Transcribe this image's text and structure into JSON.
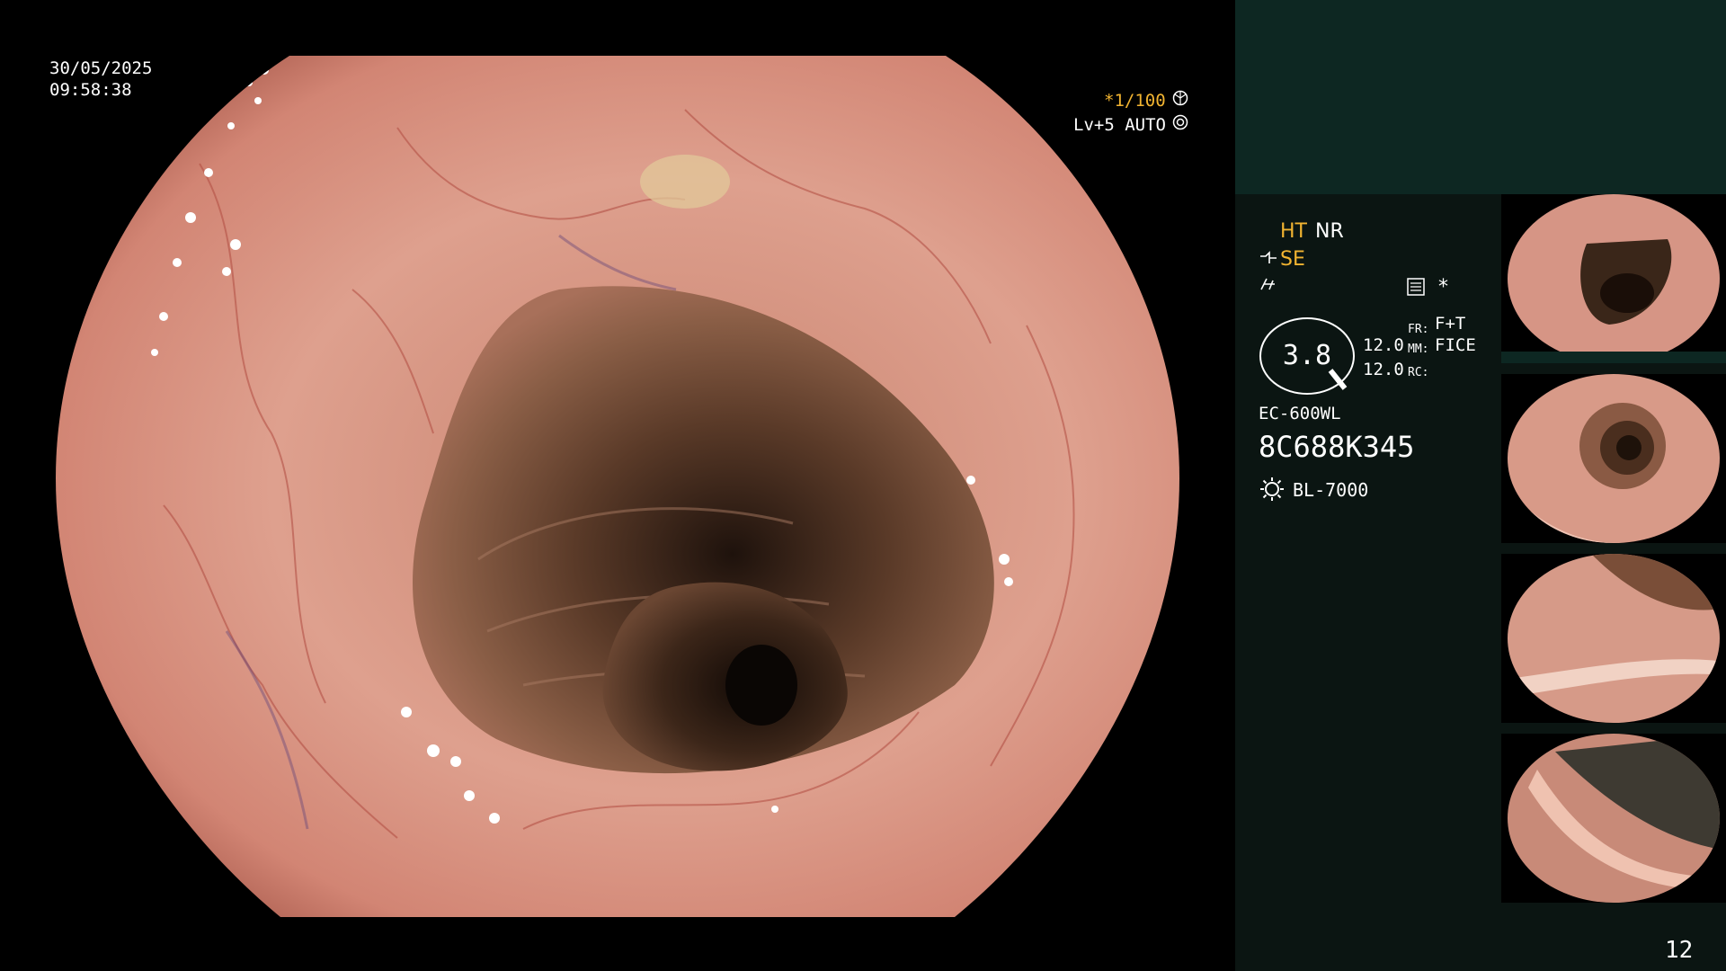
{
  "overlay": {
    "date": "30/05/2025",
    "time": "09:58:38",
    "shutter": "*1/100",
    "light_level": "Lv+5 AUTO"
  },
  "side_panel": {
    "ht": "HT",
    "nr": "NR",
    "se": "SE",
    "asterisk": "*",
    "zoom_value": "3.8",
    "value_1": "12.0",
    "value_2": "12.0",
    "fr_label": "FR:",
    "mm_label": "MM:",
    "rc_label": "RC:",
    "fr_value": "F+T",
    "mm_value": "FICE",
    "scope_model": "EC-600WL",
    "scope_serial": "8C688K345",
    "light_source": "BL-7000",
    "page_number": "12"
  },
  "icons": {
    "shutter": "aperture-icon",
    "auto": "auto-exposure-icon",
    "structure": "structure-enhancement-icon",
    "color": "color-enhancement-icon",
    "document": "document-list-icon",
    "zoom": "magnifier-icon",
    "lamp": "lamp-icon"
  },
  "colors": {
    "highlight": "#f2b431",
    "panel_bg": "#0b1512",
    "panel_header": "#0d2722",
    "mucosa": "#d99080",
    "lumen": "#3a2418"
  }
}
